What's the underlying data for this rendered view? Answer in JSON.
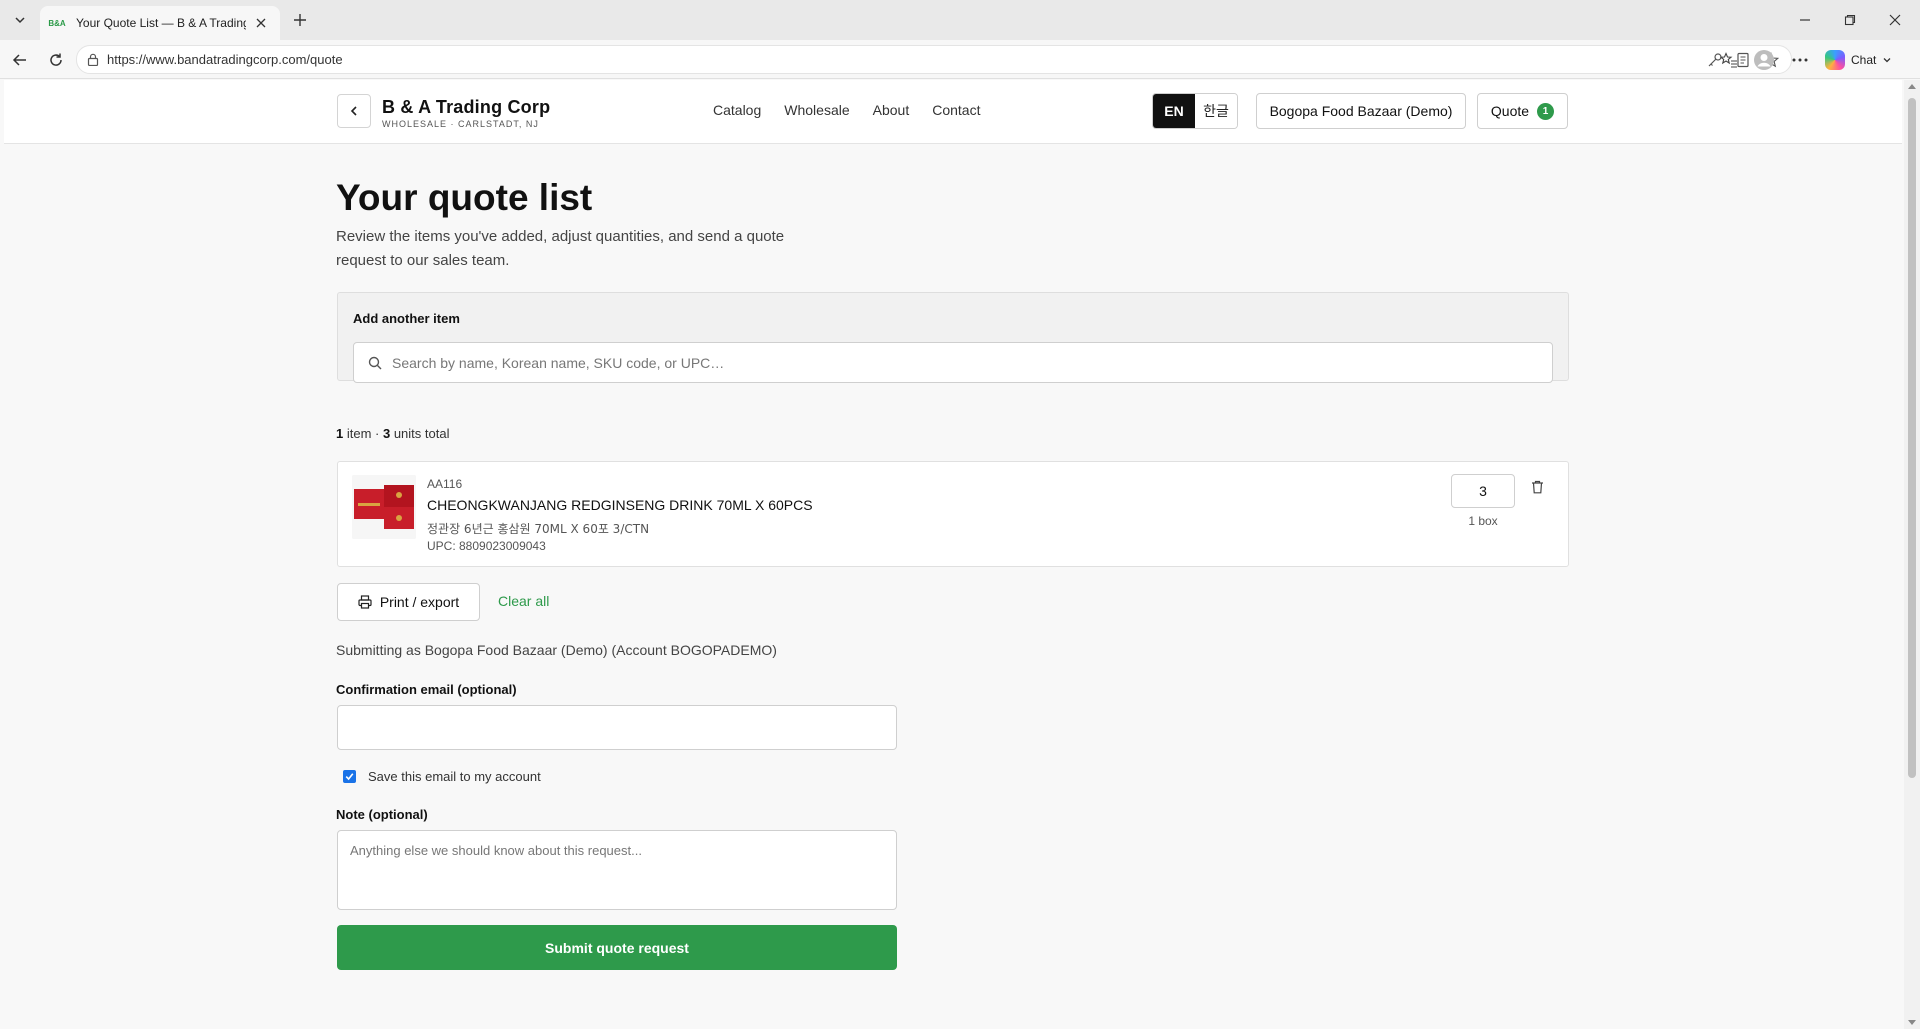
{
  "browser": {
    "tab_title": "Your Quote List — B & A Trading Corp",
    "tab_favicon": "B&A",
    "url": "https://www.bandatradingcorp.com/quote",
    "chat_label": "Chat"
  },
  "header": {
    "brand_name": "B & A Trading Corp",
    "brand_tagline": "WHOLESALE · CARLSTADT, NJ",
    "nav": [
      "Catalog",
      "Wholesale",
      "About",
      "Contact"
    ],
    "lang_en": "EN",
    "lang_ko": "한글",
    "account_label": "Bogopa Food Bazaar (Demo)",
    "quote_label": "Quote",
    "quote_count": "1"
  },
  "page": {
    "title": "Your quote list",
    "subtitle": "Review the items you've added, adjust quantities, and send a quote request to our sales team."
  },
  "add_item": {
    "label": "Add another item",
    "search_placeholder": "Search by name, Korean name, SKU code, or UPC…"
  },
  "summary": {
    "item_count": "1",
    "item_word": " item · ",
    "unit_count": "3",
    "unit_word": " units total"
  },
  "items": [
    {
      "sku": "AA116",
      "name": "CHEONGKWANJANG REDGINSENG DRINK 70ML X 60PCS",
      "korean_name": "정관장 6년근 홍삼원 70ML X 60포 3/CTN",
      "upc": "UPC: 8809023009043",
      "quantity": "3",
      "unit_label": "1 box"
    }
  ],
  "actions": {
    "print_label": "Print / export",
    "clear_label": "Clear all"
  },
  "form": {
    "submitting_as": "Submitting as Bogopa Food Bazaar (Demo) (Account BOGOPADEMO)",
    "email_label": "Confirmation email (optional)",
    "email_value": "",
    "save_email_label": "Save this email to my account",
    "save_email_checked": true,
    "note_label": "Note (optional)",
    "note_placeholder": "Anything else we should know about this request...",
    "submit_label": "Submit quote request"
  },
  "colors": {
    "accent_green": "#2e9a4b",
    "checkbox_blue": "#1a73e8"
  }
}
